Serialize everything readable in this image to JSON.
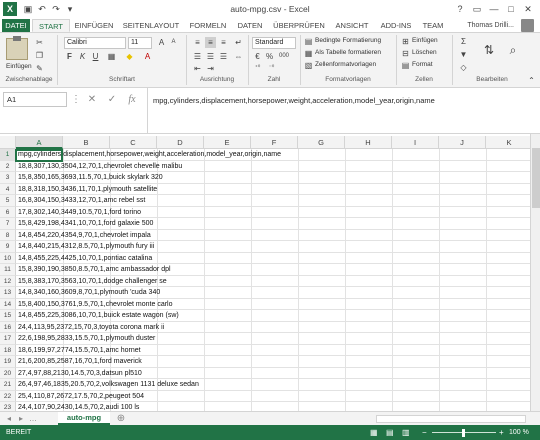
{
  "titlebar": {
    "app_icon": "X",
    "doc_title": "auto-mpg.csv - Excel",
    "icons": [
      "save-icon",
      "undo-icon",
      "redo-icon",
      "customize-icon"
    ],
    "window_buttons": [
      "?",
      "▭",
      "—",
      "□",
      "✕"
    ]
  },
  "tabs": {
    "file": "DATEI",
    "items": [
      "START",
      "EINFÜGEN",
      "SEITENLAYOUT",
      "FORMELN",
      "DATEN",
      "ÜBERPRÜFEN",
      "ANSICHT",
      "ADD-INS",
      "TEAM"
    ],
    "user": "Thomas Drilli..."
  },
  "ribbon": {
    "clipboard": {
      "paste": "Einfügen",
      "label": "Zwischenablage"
    },
    "font": {
      "name": "Calibri",
      "size": "11",
      "label": "Schriftart",
      "bold": "F",
      "italic": "K",
      "underline": "U"
    },
    "alignment": {
      "label": "Ausrichtung"
    },
    "number": {
      "format": "Standard",
      "label": "Zahl",
      "percent": "%",
      "thousands": "000"
    },
    "styles": {
      "conditional": "Bedingte Formatierung",
      "as_table": "Als Tabelle formatieren",
      "cell_styles": "Zellenformatvorlagen",
      "label": "Formatvorlagen"
    },
    "cells": {
      "insert": "Einfügen",
      "delete": "Löschen",
      "format": "Format",
      "label": "Zellen"
    },
    "editing": {
      "label": "Bearbeiten"
    }
  },
  "formula_bar": {
    "name_box": "A1",
    "content": "mpg,cylinders,displacement,horsepower,weight,acceleration,model_year,origin,name"
  },
  "grid": {
    "columns": [
      "A",
      "B",
      "C",
      "D",
      "E",
      "F",
      "G",
      "H",
      "I",
      "J",
      "K"
    ],
    "active_column": "A",
    "active_row": 1,
    "rows": [
      {
        "num": "1",
        "text": "mpg,cylinders,displacement,horsepower,weight,acceleration,model_year,origin,name"
      },
      {
        "num": "2",
        "text": "18,8,307,130,3504,12,70,1,chevrolet chevelle malibu"
      },
      {
        "num": "3",
        "text": "15,8,350,165,3693,11.5,70,1,buick skylark 320"
      },
      {
        "num": "4",
        "text": "18,8,318,150,3436,11,70,1,plymouth satellite"
      },
      {
        "num": "5",
        "text": "16,8,304,150,3433,12,70,1,amc rebel sst"
      },
      {
        "num": "6",
        "text": "17,8,302,140,3449,10.5,70,1,ford torino"
      },
      {
        "num": "7",
        "text": "15,8,429,198,4341,10,70,1,ford galaxie 500"
      },
      {
        "num": "8",
        "text": "14,8,454,220,4354,9,70,1,chevrolet impala"
      },
      {
        "num": "9",
        "text": "14,8,440,215,4312,8.5,70,1,plymouth fury iii"
      },
      {
        "num": "10",
        "text": "14,8,455,225,4425,10,70,1,pontiac catalina"
      },
      {
        "num": "11",
        "text": "15,8,390,190,3850,8.5,70,1,amc ambassador dpl"
      },
      {
        "num": "12",
        "text": "15,8,383,170,3563,10,70,1,dodge challenger se"
      },
      {
        "num": "13",
        "text": "14,8,340,160,3609,8,70,1,plymouth 'cuda 340"
      },
      {
        "num": "14",
        "text": "15,8,400,150,3761,9.5,70,1,chevrolet monte carlo"
      },
      {
        "num": "15",
        "text": "14,8,455,225,3086,10,70,1,buick estate wagon (sw)"
      },
      {
        "num": "16",
        "text": "24,4,113,95,2372,15,70,3,toyota corona mark ii"
      },
      {
        "num": "17",
        "text": "22,6,198,95,2833,15.5,70,1,plymouth duster"
      },
      {
        "num": "18",
        "text": "18,6,199,97,2774,15.5,70,1,amc hornet"
      },
      {
        "num": "19",
        "text": "21,6,200,85,2587,16,70,1,ford maverick"
      },
      {
        "num": "20",
        "text": "27,4,97,88,2130,14.5,70,3,datsun pl510"
      },
      {
        "num": "21",
        "text": "26,4,97,46,1835,20.5,70,2,volkswagen 1131 deluxe sedan"
      },
      {
        "num": "22",
        "text": "25,4,110,87,2672,17.5,70,2,peugeot 504"
      },
      {
        "num": "23",
        "text": "24,4,107,90,2430,14.5,70,2,audi 100 ls"
      }
    ]
  },
  "sheetbar": {
    "tab": "auto-mpg"
  },
  "statusbar": {
    "status": "BEREIT",
    "zoom": "100 %"
  }
}
